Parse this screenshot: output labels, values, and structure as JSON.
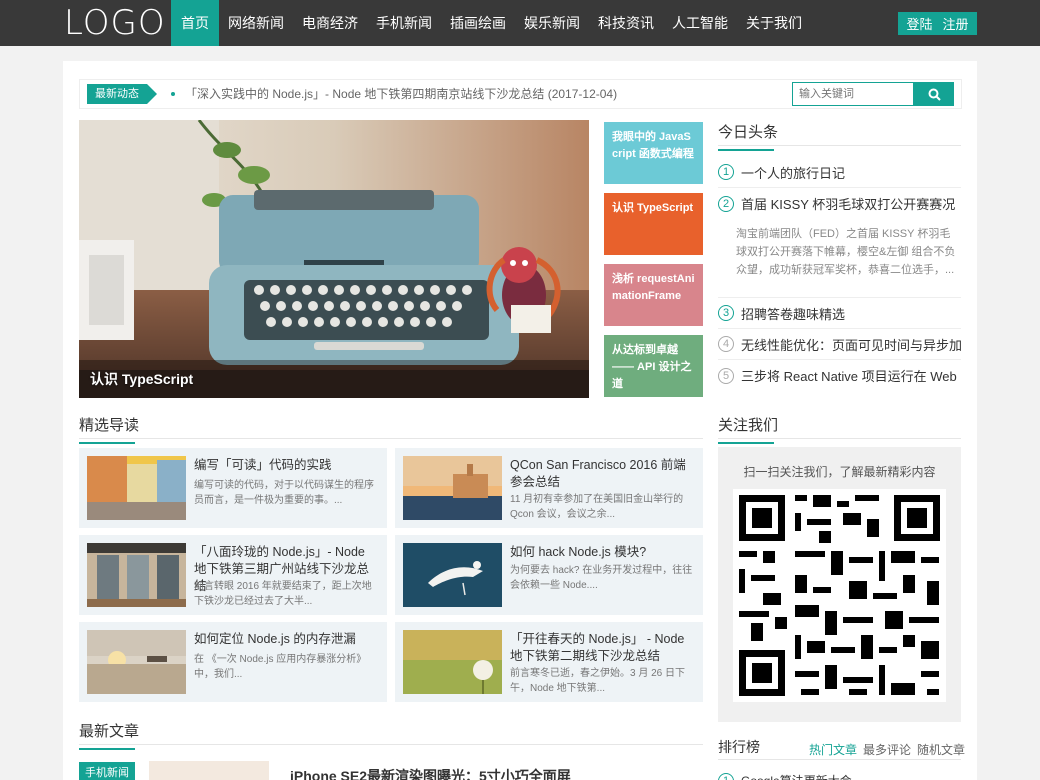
{
  "header": {
    "logo": "LOGO",
    "nav": [
      "首页",
      "网络新闻",
      "电商经济",
      "手机新闻",
      "插画绘画",
      "娱乐新闻",
      "科技资讯",
      "人工智能",
      "关于我们"
    ],
    "login": "登陆",
    "register": "注册"
  },
  "ticker": {
    "badge": "最新动态",
    "text": "「深入实践中的 Node.js」- Node 地下铁第四期南京站线下沙龙总结 (2017-12-04)",
    "search_placeholder": "输入关键词"
  },
  "hero": {
    "caption": "认识 TypeScript"
  },
  "tiles": [
    {
      "label": "我眼中的 JavaScript 函数式编程",
      "color": "#6ccad6"
    },
    {
      "label": "认识 TypeScript",
      "color": "#e8612c"
    },
    {
      "label": "浅析 requestAnimationFrame",
      "color": "#d8858c"
    },
    {
      "label": "从达标到卓越 —— API 设计之道",
      "color": "#6fad7e"
    }
  ],
  "today": {
    "title": "今日头条",
    "items": [
      {
        "n": "1",
        "text": "一个人的旅行日记"
      },
      {
        "n": "2",
        "text": "首届 KISSY 杯羽毛球双打公开赛赛况"
      },
      {
        "n": "3",
        "text": "招聘答卷趣味精选"
      },
      {
        "n": "4",
        "text": "无线性能优化：页面可见时间与异步加"
      },
      {
        "n": "5",
        "text": "三步将 React Native 项目运行在 Web"
      }
    ],
    "desc": "淘宝前端团队（FED）之首届 KISSY 杯羽毛球双打公开赛落下帷幕，樱空&左御 组合不负众望，成功斩获冠军奖杯，恭喜二位选手，..."
  },
  "featured": {
    "title": "精选导读",
    "cards": [
      {
        "title": "编写「可读」代码的实践",
        "desc": "编写可读的代码，对于以代码谋生的程序员而言，是一件极为重要的事。..."
      },
      {
        "title": "QCon San Francisco 2016 前端参会总结",
        "desc": "11 月初有幸参加了在美国旧金山举行的 Qcon 会议，会议之余..."
      },
      {
        "title": "「八面玲珑的 Node.js」- Node 地下铁第三期广州站线下沙龙总结",
        "desc": "前言转眼 2016 年就要结束了，距上次地下铁沙龙已经过去了大半..."
      },
      {
        "title": "如何 hack Node.js 模块?",
        "desc": "为何要去 hack? 在业务开发过程中，往往会依赖一些 Node...."
      },
      {
        "title": "如何定位 Node.js 的内存泄漏",
        "desc": "在 《一次 Node.js 应用内存暴涨分析》中，我们..."
      },
      {
        "title": "「开往春天的 Node.js」 - Node 地下铁第二期线下沙龙总结",
        "desc": "前言寒冬已逝，春之伊始。3 月 26 日下午，Node 地下铁第..."
      }
    ]
  },
  "follow": {
    "title": "关注我们",
    "text": "扫一扫关注我们，了解最新精彩内容"
  },
  "rank": {
    "title": "排行榜",
    "tabs": [
      "热门文章",
      "最多评论",
      "随机文章"
    ],
    "first": "Google算法更新大会"
  },
  "latest": {
    "title": "最新文章",
    "tag": "手机新闻",
    "headline": "iPhone SE2最新渲染图曝光：5寸小巧全面屏"
  }
}
